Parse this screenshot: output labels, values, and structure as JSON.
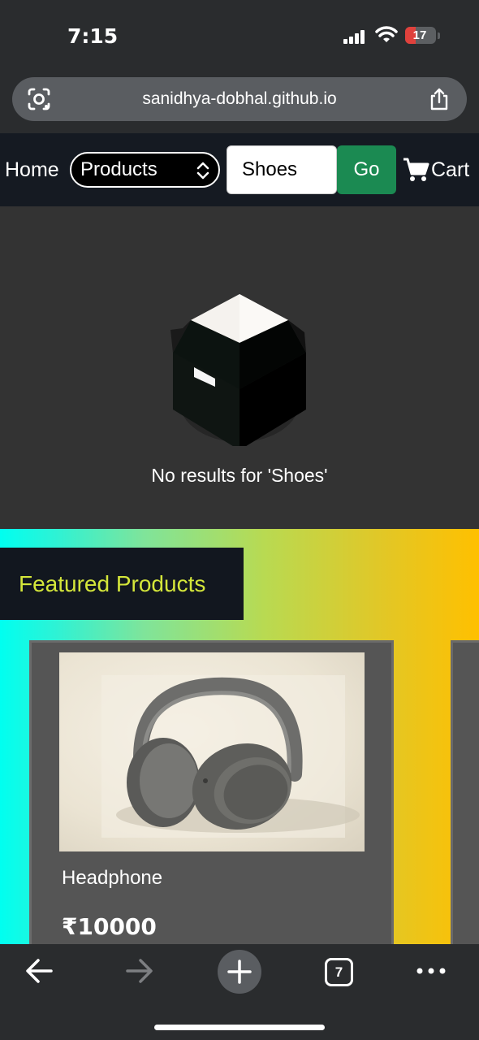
{
  "status_bar": {
    "time": "7:15",
    "battery": "17"
  },
  "address_bar": {
    "url": "sanidhya-dobhal.github.io"
  },
  "nav": {
    "home_label": "Home",
    "category_selected": "Products",
    "search_value": "Shoes",
    "go_label": "Go",
    "cart_label": "Cart"
  },
  "search_results": {
    "message": "No results for 'Shoes'"
  },
  "featured": {
    "heading": "Featured Products",
    "products": [
      {
        "name": "Headphone",
        "price": "₹10000"
      }
    ]
  },
  "toolbar": {
    "tabs_count": "7"
  },
  "colors": {
    "nav_bg": "#151a22",
    "go_button": "#1b8a52",
    "featured_heading_text": "#d4e63a",
    "gradient_start": "#00fff0",
    "gradient_end": "#ffc000"
  },
  "icons": [
    "lens-icon",
    "share-icon",
    "select-arrows-icon",
    "cart-icon",
    "box-icon",
    "back-icon",
    "forward-icon",
    "plus-icon",
    "more-icon"
  ]
}
